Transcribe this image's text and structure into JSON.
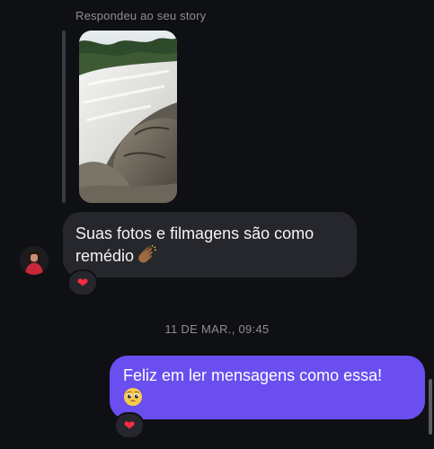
{
  "story_reply": {
    "label": "Respondeu ao seu story"
  },
  "received_message": {
    "text": "Suas fotos e filmagens são como remédio",
    "emoji": "clapping-hands-medium-dark-skin",
    "reaction": "❤"
  },
  "timestamp": "11 DE MAR., 09:45",
  "sent_message": {
    "text": "Feliz em ler mensagens como essa!",
    "emoji": "pleading-face",
    "reaction": "❤"
  },
  "colors": {
    "background": "#0f1014",
    "received_bubble": "#26272c",
    "sent_bubble": "#6a4ef0",
    "heart": "#ff2b48",
    "muted_text": "#8e8e93"
  }
}
